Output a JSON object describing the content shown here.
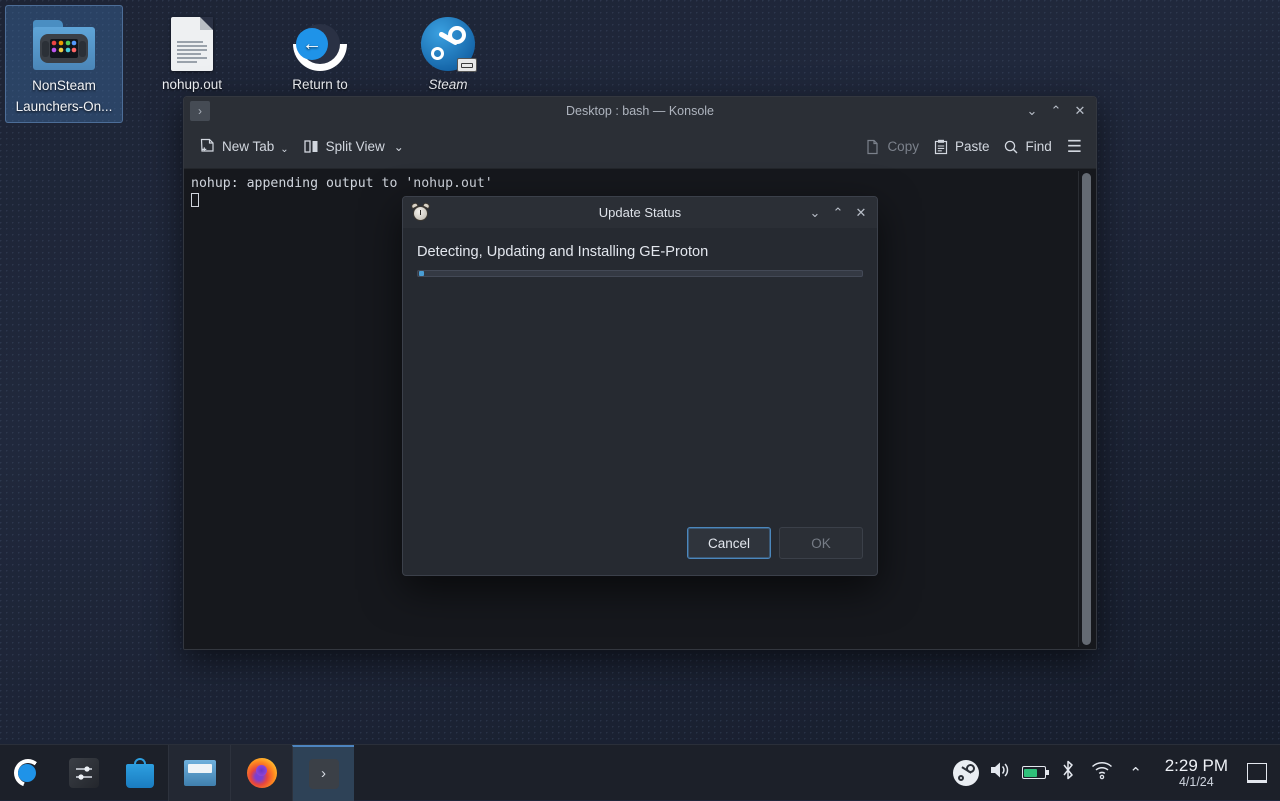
{
  "desktop": {
    "icons": [
      {
        "name": "NonSteam Launchers-On...",
        "icon": "folder-icon",
        "selected": true,
        "italic": false
      },
      {
        "name": "nohup.out",
        "icon": "text-file-icon",
        "selected": false,
        "italic": false
      },
      {
        "name": "Return to",
        "icon": "return-to-icon",
        "selected": false,
        "italic": false
      },
      {
        "name": "Steam",
        "icon": "steam-shortcut-icon",
        "selected": false,
        "italic": true
      }
    ]
  },
  "konsole": {
    "title": "Desktop : bash — Konsole",
    "window_icon": "›",
    "window_buttons": {
      "minimize": "⌄",
      "maximize": "⌃",
      "close": "✕"
    },
    "toolbar": {
      "new_tab": "New Tab",
      "new_tab_chevron": "⌄",
      "split_view": "Split View",
      "split_view_chevron": "⌄",
      "copy": "Copy",
      "copy_disabled": true,
      "paste": "Paste",
      "find": "Find",
      "hamburger": "☰"
    },
    "terminal_line": "nohup: appending output to 'nohup.out'"
  },
  "dialog": {
    "title": "Update Status",
    "icon": "alarm-clock-icon",
    "window_buttons": {
      "minimize": "⌄",
      "maximize": "⌃",
      "close": "✕"
    },
    "message": "Detecting, Updating and Installing GE-Proton",
    "progress": {
      "value": 1,
      "max": 100,
      "indeterminate": true,
      "accent": "#4a9ed4"
    },
    "buttons": {
      "cancel": "Cancel",
      "ok": "OK",
      "ok_disabled": true,
      "focused": "cancel"
    }
  },
  "taskbar": {
    "launchers": [
      {
        "name": "application-launcher",
        "icon": "kde-plasma-icon"
      },
      {
        "name": "system-settings",
        "icon": "sliders-icon"
      },
      {
        "name": "discover",
        "icon": "shopping-bag-icon"
      }
    ],
    "tasks": [
      {
        "name": "file-manager",
        "icon": "folder-icon",
        "active": false
      },
      {
        "name": "firefox",
        "icon": "firefox-icon",
        "active": false
      },
      {
        "name": "konsole",
        "icon": "terminal-icon",
        "active": true
      }
    ],
    "tray": [
      {
        "name": "steam-tray",
        "icon": "steam-icon"
      },
      {
        "name": "volume",
        "icon": "speaker-icon"
      },
      {
        "name": "battery",
        "icon": "battery-charging-icon"
      },
      {
        "name": "bluetooth",
        "icon": "bluetooth-icon"
      },
      {
        "name": "network",
        "icon": "wifi-icon"
      },
      {
        "name": "expand-tray",
        "icon": "chevron-up-icon",
        "glyph": "⌃"
      }
    ],
    "clock": {
      "time": "2:29 PM",
      "date": "4/1/24"
    },
    "show_desktop": "show-desktop-button"
  }
}
